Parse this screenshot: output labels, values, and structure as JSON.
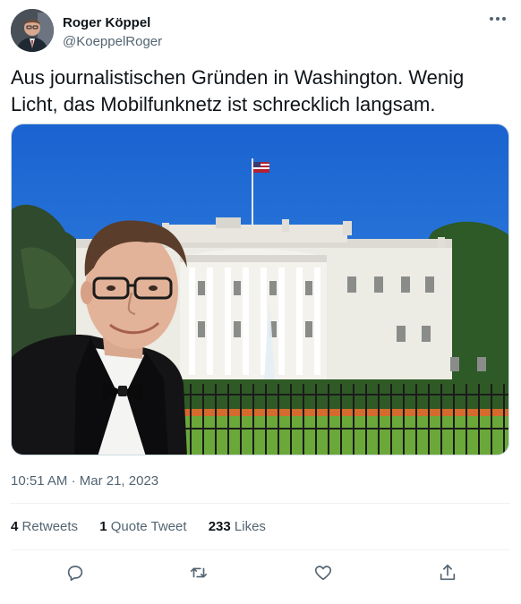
{
  "user": {
    "display_name": "Roger Köppel",
    "handle": "@KoeppelRoger"
  },
  "tweet": {
    "text": "Aus journalistischen Gründen in Washington. Wenig Licht, das Mobilfunknetz ist schrecklich langsam.",
    "time": "10:51 AM",
    "separator": "·",
    "date": "Mar 21, 2023"
  },
  "stats": {
    "retweets_count": "4",
    "retweets_label": "Retweets",
    "quotes_count": "1",
    "quotes_label": "Quote Tweet",
    "likes_count": "233",
    "likes_label": "Likes"
  },
  "icons": {
    "more": "more-horizontal-icon",
    "reply": "reply-icon",
    "retweet": "retweet-icon",
    "like": "heart-icon",
    "share": "share-icon"
  },
  "colors": {
    "text_primary": "#0f1419",
    "text_secondary": "#536471",
    "divider": "#eff3f4",
    "sky": "#1e6fd6"
  }
}
